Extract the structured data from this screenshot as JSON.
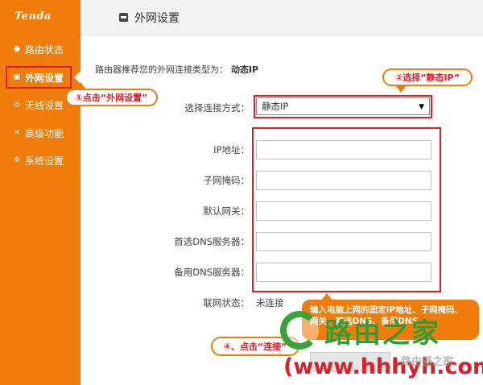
{
  "brand": "Tenda",
  "sidebar": {
    "items": [
      {
        "label": "路由状态",
        "icon": "dot-icon"
      },
      {
        "label": "外网设置",
        "icon": "monitor-icon"
      },
      {
        "label": "无线设置",
        "icon": "wifi-icon"
      },
      {
        "label": "高级功能",
        "icon": "tools-icon"
      },
      {
        "label": "系统设置",
        "icon": "gear-icon"
      }
    ]
  },
  "header": {
    "title": "外网设置"
  },
  "recommend": {
    "text": "路由器推荐您的外网连接类型为：",
    "value": "动态IP"
  },
  "form": {
    "connection_label": "选择连接方式：",
    "connection_value": "静态IP",
    "fields": [
      {
        "label": "IP地址：",
        "value": ""
      },
      {
        "label": "子网掩码：",
        "value": ""
      },
      {
        "label": "默认网关：",
        "value": ""
      },
      {
        "label": "首选DNS服务器：",
        "value": ""
      },
      {
        "label": "备用DNS服务器：",
        "value": ""
      }
    ],
    "status_label": "联网状态：",
    "status_value": "未连接"
  },
  "callouts": {
    "c1": "①点击“外网设置”",
    "c2": "②选择“静态IP”",
    "c3": "输入电脑上网的固定IP地址、子网掩码、网关、首选DNS、备用DNS",
    "c4": "④、点击“连接”"
  },
  "watermark": {
    "title": "路由之家",
    "url": "(www.hhhyh.com)",
    "small": "路由器之家"
  },
  "colors": {
    "accent": "#f07d0a",
    "highlight": "#d9202a",
    "watermark_green": "#2f9e36"
  }
}
